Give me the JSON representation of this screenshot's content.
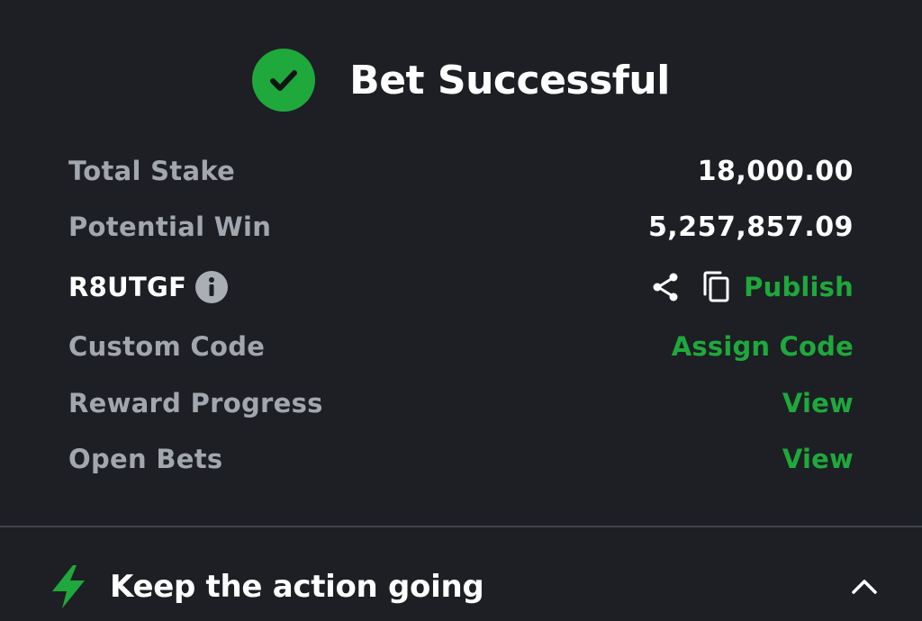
{
  "header": {
    "title": "Bet Successful",
    "icon": "check-circle-icon",
    "accent_color": "#1fa83c"
  },
  "summary": {
    "total_stake_label": "Total Stake",
    "total_stake_value": "18,000.00",
    "potential_win_label": "Potential Win",
    "potential_win_value": "5,257,857.09"
  },
  "booking": {
    "code": "R8UTGF",
    "info_icon": "info-icon",
    "share_icon": "share-icon",
    "copy_icon": "copy-icon",
    "publish_label": "Publish"
  },
  "custom_code": {
    "label": "Custom Code",
    "action": "Assign Code"
  },
  "reward_progress": {
    "label": "Reward Progress",
    "action": "View"
  },
  "open_bets": {
    "label": "Open Bets",
    "action": "View"
  },
  "footer": {
    "title": "Keep the action going",
    "icon": "lightning-bolt-icon",
    "toggle_icon": "chevron-up-icon"
  }
}
